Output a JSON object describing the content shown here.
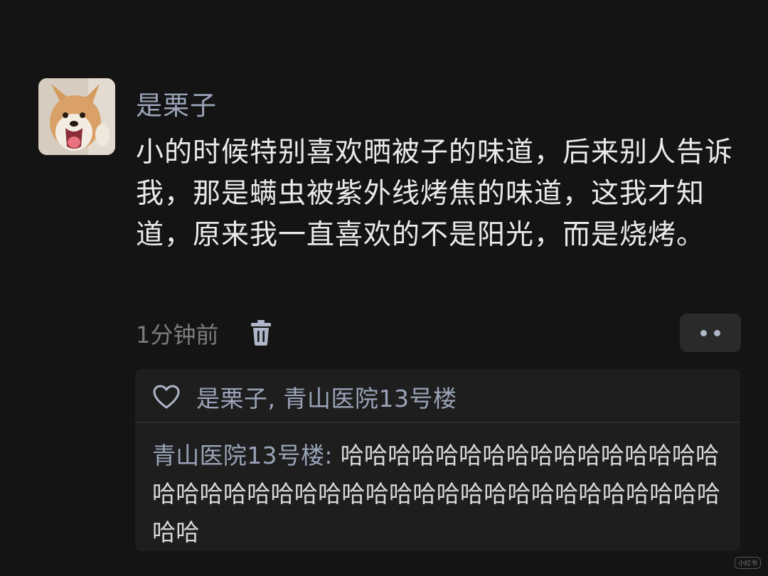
{
  "comment": {
    "author": "是栗子",
    "avatar_icon": "shiba-dog-avatar",
    "text": "小的时候特别喜欢晒被子的味道，后来别人告诉我，那是螨虫被紫外线烤焦的味道，这我才知道，原来我一直喜欢的不是阳光，而是烧烤。",
    "time": "1分钟前",
    "delete_icon": "trash-icon",
    "more_icon": "more-dots-icon"
  },
  "likes": {
    "icon": "heart-icon",
    "names": "是栗子, 青山医院13号楼"
  },
  "reply": {
    "author": "青山医院13号楼",
    "separator": ": ",
    "text": "哈哈哈哈哈哈哈哈哈哈哈哈哈哈哈哈哈哈哈哈哈哈哈哈哈哈哈哈哈哈哈哈哈哈哈哈哈哈哈哈哈哈"
  },
  "watermark": "小红书",
  "colors": {
    "background": "#141414",
    "panel": "#1e1e1e",
    "name_accent": "#9aa3b8",
    "text": "#eaeaea",
    "muted": "#7d7d7d"
  }
}
